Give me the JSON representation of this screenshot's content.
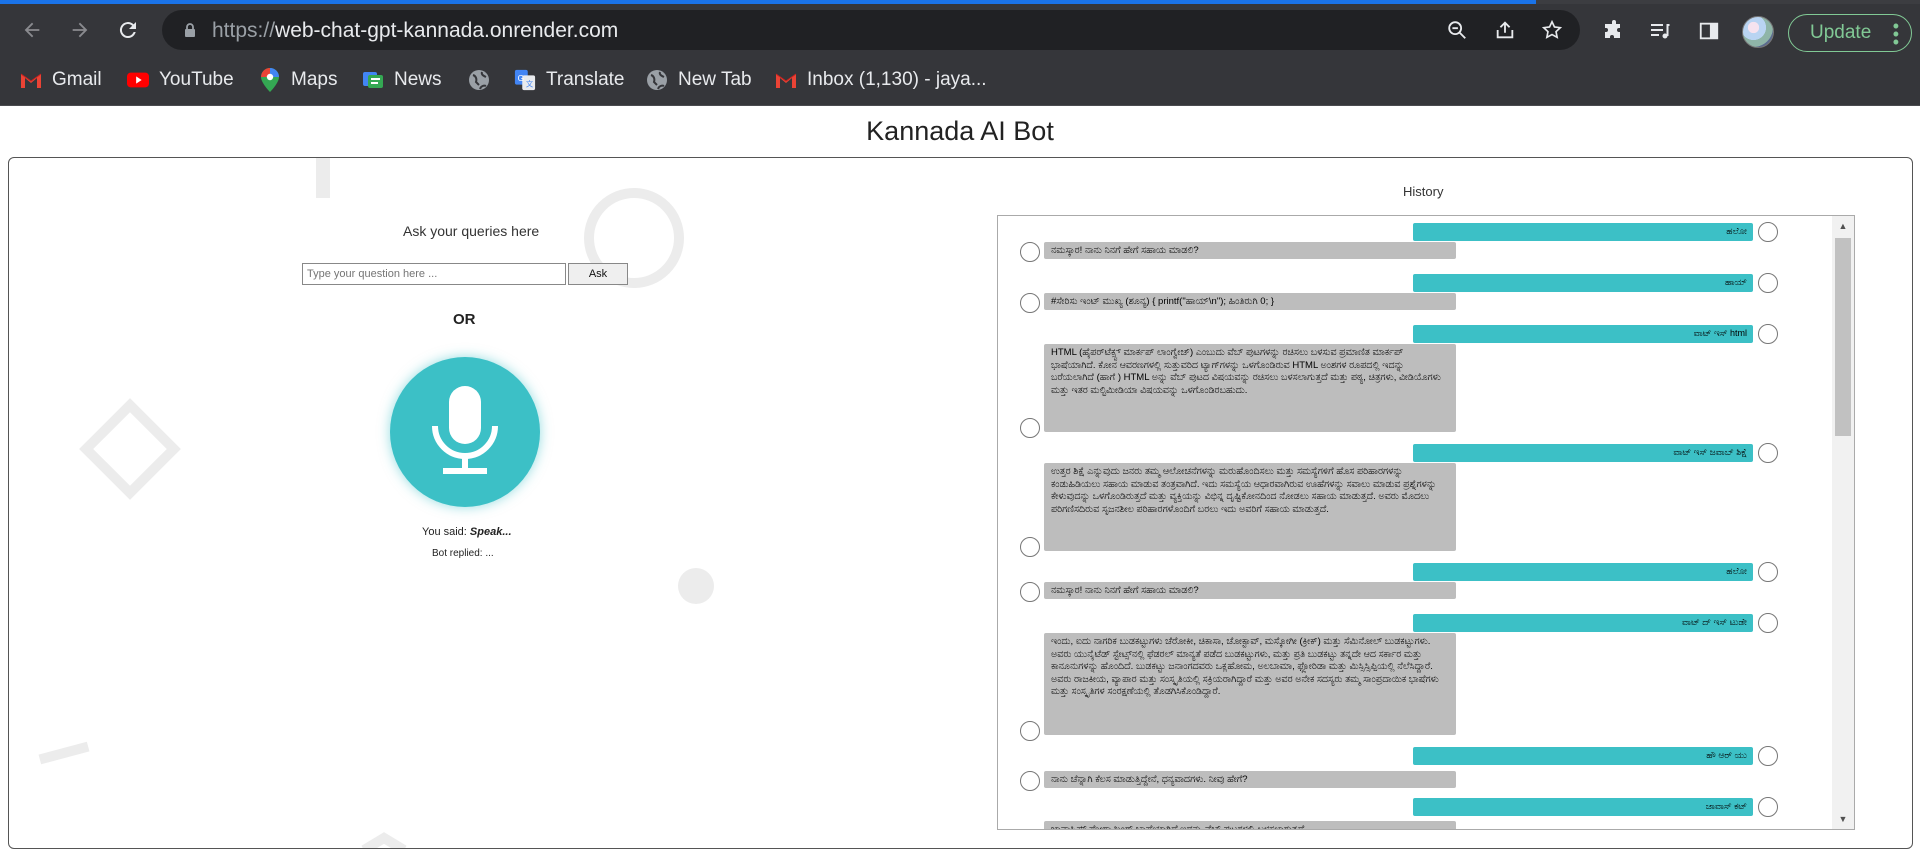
{
  "browser": {
    "url_scheme": "https://",
    "url_host": "web-chat-gpt-kannada.onrender.com",
    "update_label": "Update",
    "load_progress_pct": 80
  },
  "bookmarks": [
    {
      "label": "Gmail",
      "icon": "gmail-icon"
    },
    {
      "label": "YouTube",
      "icon": "youtube-icon"
    },
    {
      "label": "Maps",
      "icon": "maps-icon"
    },
    {
      "label": "News",
      "icon": "news-icon"
    },
    {
      "label": "",
      "icon": "globe-icon"
    },
    {
      "label": "Translate",
      "icon": "translate-icon"
    },
    {
      "label": "New Tab",
      "icon": "globe-icon"
    },
    {
      "label": "Inbox (1,130) - jaya...",
      "icon": "gmail-icon"
    }
  ],
  "page": {
    "title": "Kannada AI Bot",
    "ask_title": "Ask your queries here",
    "input_placeholder": "Type your question here ...",
    "ask_label": "Ask",
    "or_label": "OR",
    "you_said_label": "You said:",
    "you_said_value": "Speak...",
    "bot_replied_label": "Bot replied:",
    "bot_replied_value": "...",
    "history_label": "History"
  },
  "colors": {
    "accent": "#3cc0c6",
    "bot_bubble": "#bdbdbd",
    "chrome_bg": "#35363a"
  },
  "history": [
    {
      "role": "user",
      "text": "ಹಲೋ"
    },
    {
      "role": "bot",
      "text": "ನಮಸ್ಕಾರ! ನಾನು ನಿನಗೆ ಹೇಗೆ ಸಹಾಯ ಮಾಡಲಿ?"
    },
    {
      "role": "user",
      "text": "ಹಾಯ್"
    },
    {
      "role": "bot",
      "text": "#ಸೇರಿಸು ಇಂಟ್ ಮುಖ್ಯ (ಶೂನ್ಯ) { printf(\"ಹಾಯ್\\n\"); ಹಿಂತಿರುಗಿ 0; }"
    },
    {
      "role": "user",
      "text": "ವಾಟ್ ಇಸ್ html"
    },
    {
      "role": "bot",
      "text": "HTML (ಹೈಪರ್‌ಟೆಕ್ಸ್ಟ್ ಮಾರ್ಕಪ್ ಲಾಂಗ್ವೇಜ್) ಎಂಬುದು ವೆಬ್ ಪುಟಗಳನ್ನು ರಚಿಸಲು ಬಳಸುವ ಪ್ರಮಾಣಿತ ಮಾರ್ಕಪ್ ಭಾಷೆಯಾಗಿದೆ. ಕೋನ ಆವರಣಗಳಲ್ಲಿ ಸುತ್ತುವರಿದ ಟ್ಯಾಗ್‌ಗಳನ್ನು ಒಳಗೊಂಡಿರುವ HTML ಅಂಶಗಳ ರೂಪದಲ್ಲಿ ಇದನ್ನು ಬರೆಯಲಾಗಿದೆ (ಹಾಗೆ ) HTML ಅನ್ನು ವೆಬ್ ಪುಟದ ವಿಷಯವನ್ನು ರಚಿಸಲು ಬಳಸಲಾಗುತ್ತದೆ ಮತ್ತು ಪಠ್ಯ, ಚಿತ್ರಗಳು, ವೀಡಿಯೊಗಳು ಮತ್ತು ಇತರ ಮಲ್ಟಿಮೀಡಿಯಾ ವಿಷಯವನ್ನು ಒಳಗೊಂಡಿರಬಹುದು."
    },
    {
      "role": "user",
      "text": "ವಾಟ್ ಇಸ್ ಜವಾಬ್ ಶಿಕ್ಷೆ"
    },
    {
      "role": "bot",
      "text": "ಉತ್ತರ ಶಿಕ್ಷೆ ಎನ್ನುವುದು ಜನರು ತಮ್ಮ ಆಲೋಚನೆಗಳನ್ನು ಮರುಹೊಂದಿಸಲು ಮತ್ತು ಸಮಸ್ಯೆಗಳಿಗೆ ಹೊಸ ಪರಿಹಾರಗಳನ್ನು ಕಂಡುಹಿಡಿಯಲು ಸಹಾಯ ಮಾಡುವ ತಂತ್ರವಾಗಿದೆ. ಇದು ಸಮಸ್ಯೆಯ ಆಧಾರವಾಗಿರುವ ಊಹೆಗಳನ್ನು ಸವಾಲು ಮಾಡುವ ಪ್ರಶ್ನೆಗಳನ್ನು ಕೇಳುವುದನ್ನು ಒಳಗೊಂಡಿರುತ್ತದೆ ಮತ್ತು ವ್ಯಕ್ತಿಯನ್ನು ವಿಭಿನ್ನ ದೃಷ್ಟಿಕೋನದಿಂದ ನೋಡಲು ಸಹಾಯ ಮಾಡುತ್ತದೆ. ಅವರು ಮೊದಲು ಪರಿಗಣಿಸದಿರುವ ಸೃಜನಶೀಲ ಪರಿಹಾರಗಳೊಂದಿಗೆ ಬರಲು ಇದು ಅವರಿಗೆ ಸಹಾಯ ಮಾಡುತ್ತದೆ."
    },
    {
      "role": "user",
      "text": "ಹಲೋ"
    },
    {
      "role": "bot",
      "text": "ನಮಸ್ಕಾರ! ನಾನು ನಿನಗೆ ಹೇಗೆ ಸಹಾಯ ಮಾಡಲಿ?"
    },
    {
      "role": "user",
      "text": "ವಾಟ್ ದ್ ಇಸ್ ಟುಡೇ"
    },
    {
      "role": "bot",
      "text": "ಇಂದು, ಐದು ನಾಗರಿಕ ಬುಡಕಟ್ಟುಗಳು ಚೆರೋಕೀ, ಚಿಕಾಸಾ, ಚೋಕ್ಟಾವ್, ಮಸ್ಕೋಗೀ (ಕ್ರೀಕ್) ಮತ್ತು ಸೆಮಿನೋಲ್ ಬುಡಕಟ್ಟುಗಳು. ಅವರು ಯುನೈಟೆಡ್ ಸ್ಟೇಟ್ಸ್‌ನಲ್ಲಿ ಫೆಡರಲ್ ಮಾನ್ಯತೆ ಪಡೆದ ಬುಡಕಟ್ಟುಗಳು, ಮತ್ತು ಪ್ರತಿ ಬುಡಕಟ್ಟು ತನ್ನದೇ ಆದ ಸರ್ಕಾರ ಮತ್ತು ಕಾನೂನುಗಳನ್ನು ಹೊಂದಿದೆ. ಬುಡಕಟ್ಟು ಜನಾಂಗದವರು ಒಕ್ಲಹೋಮ, ಅಲಬಾಮಾ, ಫ್ಲೋರಿಡಾ ಮತ್ತು ಮಿಸ್ಸಿಸ್ಸಿಪ್ಪಿಯಲ್ಲಿ ನೆಲೆಸಿದ್ದಾರೆ. ಅವರು ರಾಜಕೀಯ, ವ್ಯಾಪಾರ ಮತ್ತು ಸಂಸ್ಕೃತಿಯಲ್ಲಿ ಸಕ್ರಿಯರಾಗಿದ್ದಾರೆ ಮತ್ತು ಅವರ ಅನೇಕ ಸದಸ್ಯರು ತಮ್ಮ ಸಾಂಪ್ರದಾಯಿಕ ಭಾಷೆಗಳು ಮತ್ತು ಸಂಸ್ಕೃತಿಗಳ ಸಂರಕ್ಷಣೆಯಲ್ಲಿ ತೊಡಗಿಸಿಕೊಂಡಿದ್ದಾರೆ."
    },
    {
      "role": "user",
      "text": "ಹೌ ಆರ್ ಯು"
    },
    {
      "role": "bot",
      "text": "ನಾನು ಚೆನ್ನಾಗಿ ಕೆಲಸ ಮಾಡುತ್ತಿದ್ದೇನೆ, ಧನ್ಯವಾದಗಳು. ನೀವು ಹೇಗೆ?"
    },
    {
      "role": "user",
      "text": "ಜಾವಾಸ್ ಕಟ್"
    },
    {
      "role": "bot",
      "text": "ಜಾವಾಸ್ಕ್ರಿಪ್ಟ್ ಪ್ರೋಗ್ರಾಮಿಂಗ್ ಭಾಷೆಯಾಗಿದೆ ಇದನ್ನು ವೆಬ್ ಪುಟಗಳಲ್ಲಿ ಬಳಸಲಾಗುತ್ತದೆ"
    }
  ]
}
